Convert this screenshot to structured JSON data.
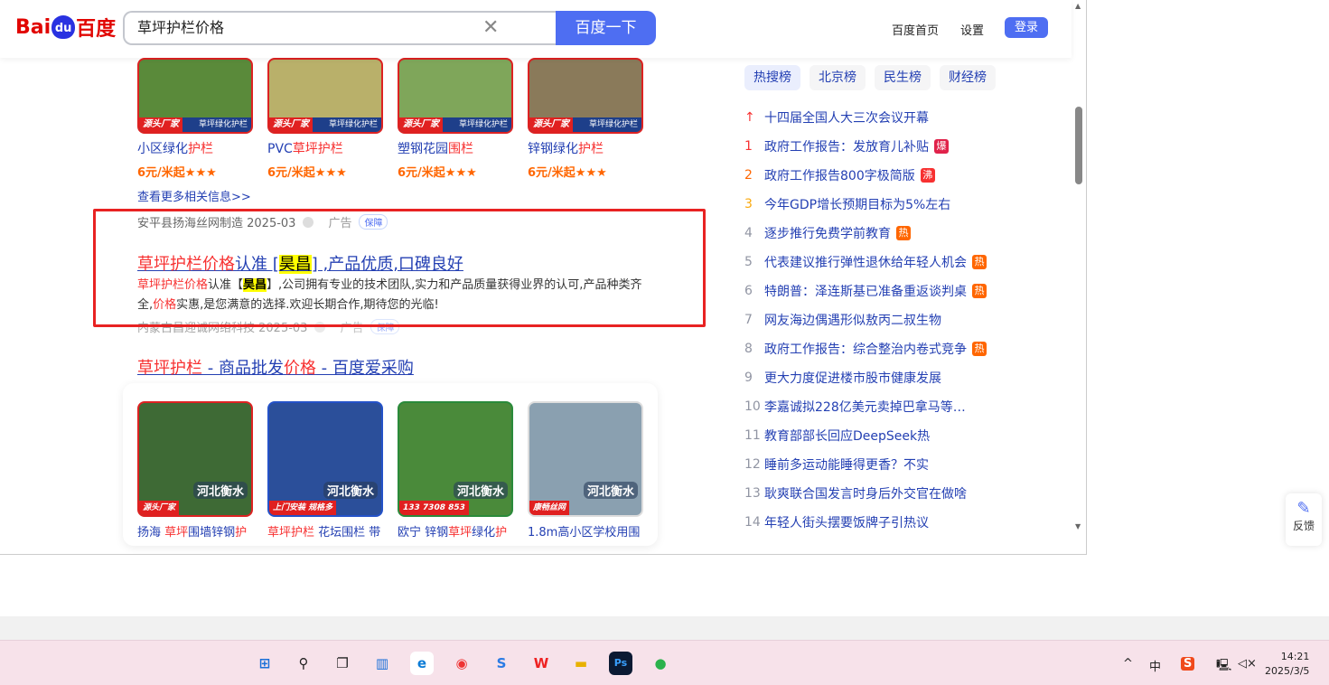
{
  "header": {
    "logo": "Bai du 百度",
    "query": "草坪护栏价格",
    "search_button": "百度一下",
    "home": "百度首页",
    "settings": "设置",
    "login": "登录"
  },
  "top_cards": [
    {
      "title_a": "小区绿化",
      "title_b": "护栏",
      "price": "6元/米起★★★",
      "tag": "源头厂家",
      "band": "草坪绿化护栏"
    },
    {
      "title_a": "PVC",
      "title_b": "草坪护栏",
      "price": "6元/米起★★★",
      "tag": "源头厂家",
      "band": "草坪绿化护栏"
    },
    {
      "title_a": "塑钢花园",
      "title_b": "围栏",
      "price": "6元/米起★★★",
      "tag": "源头厂家",
      "band": "草坪绿化护栏"
    },
    {
      "title_a": "锌钢绿化",
      "title_b": "护栏",
      "price": "6元/米起★★★",
      "tag": "源头厂家",
      "band": "草坪绿化护栏"
    }
  ],
  "more_link": "查看更多相关信息>>",
  "ad1": {
    "source": "安平县扬海丝网制造 2025-03",
    "ad": "广告",
    "badge": "保障",
    "title_hl": "草坪护栏价格",
    "title_a": "认准 [",
    "title_yel": "昊昌",
    "title_b": "] ,产品优质,口碑良好",
    "desc_hl": "草坪护栏价格",
    "desc_a": "认准【",
    "desc_yel": "昊昌",
    "desc_b": "】,公司拥有专业的技术团队,实力和产品质量获得业界的认可,产品种类齐全,",
    "desc_hl2": "价格",
    "desc_c": "实惠,是您满意的选择.欢迎长期合作,期待您的光临!"
  },
  "ad2": {
    "source": "内蒙古昌迎诚网络科技 2025-03",
    "ad": "广告",
    "badge": "保障"
  },
  "result2": {
    "hl1": "草坪护栏",
    "a": " - 商品批发",
    "hl2": "价格",
    "b": " - 百度爱采购"
  },
  "shop_cards": [
    {
      "t1": "扬海 ",
      "h1": "草坪",
      "t2": "围墙锌钢",
      "h2": "护",
      "overlay": "河北衡水",
      "tag": "源头厂家"
    },
    {
      "t1": "",
      "h1": "草坪护栏",
      "t2": " 花坛围栏 带",
      "h2": "",
      "overlay": "河北衡水",
      "tag": "上门安装 规格多"
    },
    {
      "t1": "欧宁 锌钢",
      "h1": "草坪",
      "t2": "绿化",
      "h2": "护",
      "overlay": "河北衡水",
      "tag": "133 7308 853"
    },
    {
      "t1": "1.8m高小区学校用围",
      "h1": "",
      "t2": "",
      "h2": "",
      "overlay": "河北衡水",
      "tag": "康畅丝网"
    }
  ],
  "hot_tabs": [
    "热搜榜",
    "北京榜",
    "民生榜",
    "财经榜"
  ],
  "hot_list": [
    {
      "rank": "↑",
      "text": "十四届全国人大三次会议开幕",
      "badge": ""
    },
    {
      "rank": "1",
      "text": "政府工作报告：发放育儿补贴",
      "badge": "爆"
    },
    {
      "rank": "2",
      "text": "政府工作报告800字极简版",
      "badge": "沸"
    },
    {
      "rank": "3",
      "text": "今年GDP增长预期目标为5%左右",
      "badge": ""
    },
    {
      "rank": "4",
      "text": "逐步推行免费学前教育",
      "badge": "热"
    },
    {
      "rank": "5",
      "text": "代表建议推行弹性退休给年轻人机会",
      "badge": "热"
    },
    {
      "rank": "6",
      "text": "特朗普：泽连斯基已准备重返谈判桌",
      "badge": "热"
    },
    {
      "rank": "7",
      "text": "网友海边偶遇形似敖丙二叔生物",
      "badge": ""
    },
    {
      "rank": "8",
      "text": "政府工作报告：综合整治内卷式竞争",
      "badge": "热"
    },
    {
      "rank": "9",
      "text": "更大力度促进楼市股市健康发展",
      "badge": ""
    },
    {
      "rank": "10",
      "text": "李嘉诚拟228亿美元卖掉巴拿马等…",
      "badge": ""
    },
    {
      "rank": "11",
      "text": "教育部部长回应DeepSeek热",
      "badge": ""
    },
    {
      "rank": "12",
      "text": "睡前多运动能睡得更香？不实",
      "badge": ""
    },
    {
      "rank": "13",
      "text": "耿爽联合国发言时身后外交官在做啥",
      "badge": ""
    },
    {
      "rank": "14",
      "text": "年轻人街头摆要饭牌子引热议",
      "badge": ""
    }
  ],
  "feedback": "反馈",
  "taskbar": {
    "time": "14:21",
    "date": "2025/3/5",
    "ime": "中"
  },
  "colors": {
    "accent": "#4e6ef2",
    "link": "#2440b3",
    "highlight": "#f73131",
    "price": "#ff6600",
    "annotation_box": "#e82222"
  }
}
